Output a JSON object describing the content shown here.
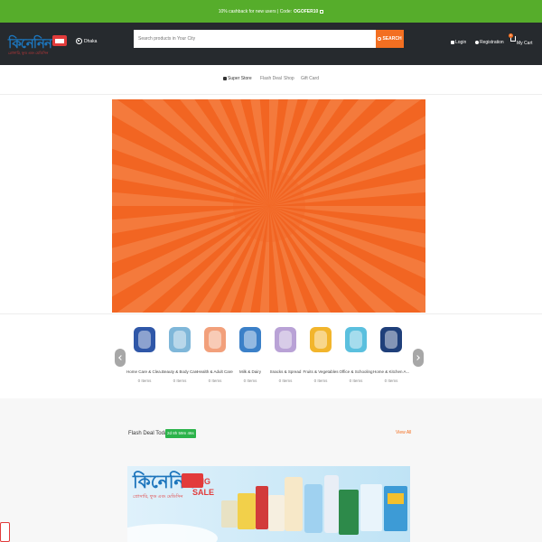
{
  "promo": {
    "text": "10% cashback for new users | Code:",
    "code": "OGOFER10"
  },
  "header": {
    "logo_text": "কিনেনিন",
    "logo_tagline": "গ্রোসারি, ফুড এবং মেডিসিন",
    "location": "Dhaka",
    "search_placeholder": "Search products in Your City",
    "search_button": "SEARCH",
    "login": "Login",
    "registration": "Registration",
    "cart_label": "My Cart",
    "cart_count": "0"
  },
  "nav": {
    "items": [
      "Super Store",
      "Flash Deal",
      "Shop",
      "Gift Card"
    ]
  },
  "categories": [
    {
      "name": "Home Care & Clea...",
      "count": "0 Items",
      "color": "#2f57a8"
    },
    {
      "name": "Beauty & Body Care",
      "count": "0 Items",
      "color": "#7fb7d9"
    },
    {
      "name": "Health & Adult Care",
      "count": "0 Items",
      "color": "#f2a07b"
    },
    {
      "name": "Milk & Dairy",
      "count": "0 Items",
      "color": "#3b80c8"
    },
    {
      "name": "Snacks & Spread",
      "count": "0 Items",
      "color": "#b9a2d6"
    },
    {
      "name": "Fruits & Vegetables",
      "count": "0 Items",
      "color": "#f2b52c"
    },
    {
      "name": "Office & Schooling",
      "count": "0 Items",
      "color": "#5bc0de"
    },
    {
      "name": "Home & Kitchen A...",
      "count": "0 Items",
      "color": "#1f3f7a"
    }
  ],
  "flash": {
    "title": "Flash Deal Today",
    "timer": "2d 8h 59m 46s",
    "view_all": "View All"
  },
  "flash_banner": {
    "logo_text": "কিনেনিন",
    "sale_top": "BIG",
    "sale_bottom": "SALE",
    "tagline": "গ্রোসারি, ফুড এবং মেডিসিন"
  },
  "colors": {
    "promo_bg": "#56ad2b",
    "header_bg": "#262a2e",
    "accent": "#f36f21",
    "banner_orange": "#f26522",
    "brand_blue": "#1c75bc",
    "brand_red": "#e23b3b"
  }
}
